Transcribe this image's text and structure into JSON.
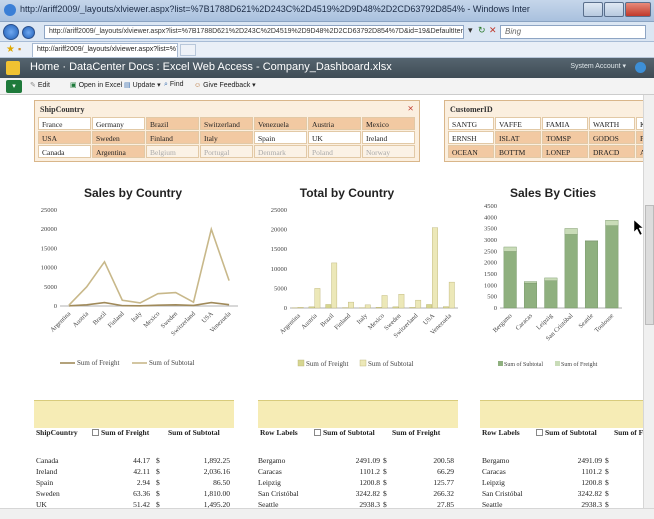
{
  "browser": {
    "window_title": "http://ariff2009/_layouts/xlviewer.aspx?list=%7B1788D621%2D243C%2D4519%2D9D48%2D2CD63792D854% - Windows Internet Explorer",
    "address": "http://ariff2009/_layouts/xlviewer.aspx?list=%7B1788D621%2D243C%2D4519%2D9D48%2D2CD63792D854%7D&id=19&DefaultItemOpen=1",
    "search_placeholder": "Bing",
    "tab_label": "http://ariff2009/_layouts/xlviewer.aspx?list=%7B78..."
  },
  "sharepoint": {
    "title": "Home · DataCenter Docs : Excel Web Access - Company_Dashboard.xlsx",
    "account": "System Account ▾"
  },
  "toolbar": {
    "edit": "Edit",
    "open_excel": "Open in Excel",
    "update": "Update ▾",
    "find": "Find",
    "feedback": "Give Feedback ▾"
  },
  "slicer_country": {
    "header": "ShipCountry",
    "rows": [
      [
        "France",
        "Germany",
        "Brazil",
        "Switzerland",
        "Venezuela",
        "Austria",
        "Mexico"
      ],
      [
        "USA",
        "Sweden",
        "Finland",
        "Italy",
        "Spain",
        "UK",
        "Ireland"
      ],
      [
        "Canada",
        "Argentina",
        "Belgium",
        "Portugal",
        "Denmark",
        "Poland",
        "Norway"
      ]
    ]
  },
  "slicer_customer": {
    "header": "CustomerID",
    "rows": [
      [
        "SANTG",
        "VAFFE",
        "FAMIA",
        "WARTH",
        "KO"
      ],
      [
        "ERNSH",
        "ISLAT",
        "TOMSP",
        "GODOS",
        "PE"
      ],
      [
        "OCEAN",
        "BOTTM",
        "LONEP",
        "DRACD",
        "AS"
      ]
    ]
  },
  "chart_data": [
    {
      "type": "line",
      "title": "Sales by Country",
      "categories": [
        "Argentina",
        "Austria",
        "Brazil",
        "Finland",
        "Italy",
        "Mexico",
        "Sweden",
        "Switzerland",
        "USA",
        "Venezuela"
      ],
      "series": [
        {
          "name": "Sum of Freight",
          "values": [
            50,
            300,
            900,
            100,
            60,
            200,
            300,
            150,
            900,
            350
          ]
        },
        {
          "name": "Sum of Subtotal",
          "values": [
            200,
            5000,
            11500,
            1500,
            800,
            3200,
            3500,
            1000,
            20000,
            6600
          ]
        }
      ],
      "ylim": [
        0,
        25000
      ],
      "yticks": [
        "0",
        "5000",
        "10000",
        "15000",
        "20000",
        "25000"
      ],
      "legend": "bottom"
    },
    {
      "type": "bar",
      "title": "Total by Country",
      "categories": [
        "Argentina",
        "Austria",
        "Brazil",
        "Finland",
        "Italy",
        "Mexico",
        "Sweden",
        "Switzerland",
        "USA",
        "Venezuela"
      ],
      "series": [
        {
          "name": "Sum of Freight",
          "values": [
            50,
            300,
            900,
            100,
            60,
            200,
            300,
            150,
            900,
            350
          ]
        },
        {
          "name": "Sum of Subtotal",
          "values": [
            200,
            5000,
            11500,
            1500,
            800,
            3200,
            3500,
            2000,
            20500,
            6600
          ]
        }
      ],
      "ylim": [
        0,
        25000
      ],
      "yticks": [
        "0",
        "5000",
        "10000",
        "15000",
        "20000",
        "25000"
      ],
      "legend": "bottom"
    },
    {
      "type": "bar",
      "title": "Sales By Cities",
      "categories": [
        "Bergamo",
        "Caracas",
        "Leipzig",
        "San Cristóbal",
        "Seattle",
        "Toulouse"
      ],
      "series": [
        {
          "name": "Sum of Subtotal",
          "values": [
            2491.09,
            1101.2,
            1200.8,
            3242.82,
            2938.3,
            3632
          ]
        },
        {
          "name": "Sum of Freight",
          "values": [
            200.58,
            66.29,
            125.77,
            266.32,
            27.85,
            240
          ]
        }
      ],
      "stacked": true,
      "ylim": [
        0,
        4500
      ],
      "yticks": [
        "0",
        "500",
        "1000",
        "1500",
        "2000",
        "2500",
        "3000",
        "3500",
        "4000",
        "4500"
      ],
      "legend": "bottom"
    }
  ],
  "pivot_country": {
    "col1": "ShipCountry",
    "col2": "Sum of Freight",
    "col3": "Sum of Subtotal",
    "rows": [
      [
        "Canada",
        "44.17",
        "$",
        "1,892.25"
      ],
      [
        "Ireland",
        "42.11",
        "$",
        "2,036.16"
      ],
      [
        "Spain",
        "2.94",
        "$",
        "86.50"
      ],
      [
        "Sweden",
        "63.36",
        "$",
        "1,810.00"
      ],
      [
        "UK",
        "51.42",
        "$",
        "1,495.20"
      ]
    ]
  },
  "pivot_rows": {
    "col1": "Row Labels",
    "col2": "Sum of Subtotal",
    "col3": "Sum of Freight",
    "rows": [
      [
        "Bergamo",
        "2491.09",
        "$",
        "200.58"
      ],
      [
        "Caracas",
        "1101.2",
        "$",
        "66.29"
      ],
      [
        "Leipzig",
        "1200.8",
        "$",
        "125.77"
      ],
      [
        "San Cristóbal",
        "3242.82",
        "$",
        "266.32"
      ],
      [
        "Seattle",
        "2938.3",
        "$",
        "27.85"
      ]
    ]
  },
  "pivot_cities": {
    "col1": "Row Labels",
    "col2": "Sum of Subtotal",
    "col3": "Sum of F",
    "rows": [
      [
        "Bergamo",
        "2491.09",
        "$"
      ],
      [
        "Caracas",
        "1101.2",
        "$"
      ],
      [
        "Leipzig",
        "1200.8",
        "$"
      ],
      [
        "San Cristóbal",
        "3242.82",
        "$"
      ],
      [
        "Seattle",
        "2938.3",
        "$"
      ]
    ]
  },
  "colors": {
    "line_freight": "#a08a5a",
    "line_subtotal": "#c8b88a",
    "bar_freight": "#d6d690",
    "bar_subtotal": "#ece8b8",
    "city_subtotal": "#8fb07f",
    "city_freight": "#c9dcb8",
    "slicer_selected": "#f2c9a2",
    "pivot_header": "#f6ecb5"
  }
}
